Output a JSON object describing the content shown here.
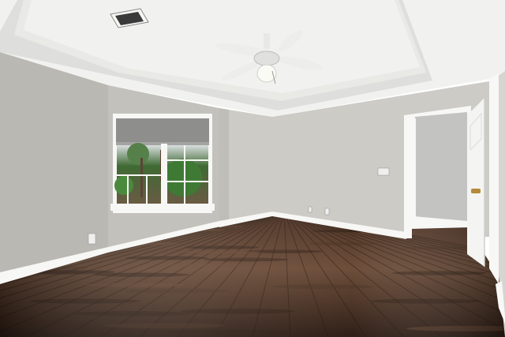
{
  "scene": {
    "subject": "empty-room",
    "elements": [
      "tray-ceiling",
      "ceiling-fan",
      "hvac-vent",
      "window",
      "doorway",
      "open-door",
      "hardwood-floor",
      "baseboard",
      "outlets",
      "light-switch"
    ]
  },
  "colors": {
    "ceiling": "#f1f1ef",
    "ceiling_shadow": "#dedfdc",
    "tray_face": "#e9e9e6",
    "wall_left": "#b9b8b3",
    "wall_window": "#c2c1bc",
    "wall_back": "#cccbc6",
    "wall_right": "#d6d5d1",
    "hallway_wall": "#c3c4c1",
    "trim": "#f7f7f5",
    "floor_dark": "#2a1a12",
    "floor_mid": "#4a3022",
    "floor_light": "#6a4a36",
    "window_greenery": "#3f6a33",
    "window_sky": "#d9dedf",
    "shade": "#8e8f8c",
    "door": "#f4f4f2",
    "hardware": "#b58a3a"
  }
}
